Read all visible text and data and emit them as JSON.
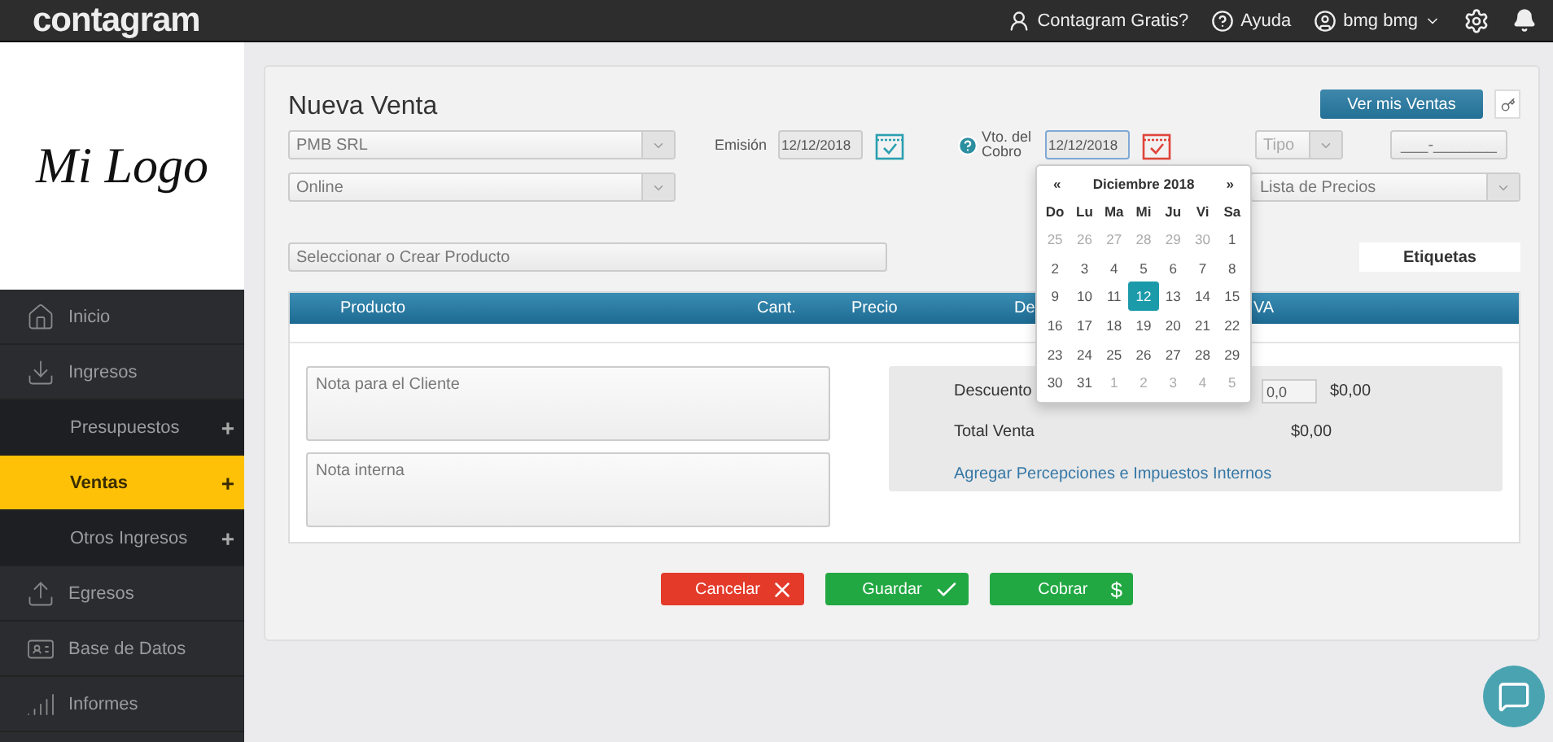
{
  "topbar": {
    "logo": "contagram",
    "links": [
      {
        "label": "Contagram Gratis?"
      },
      {
        "label": "Ayuda"
      },
      {
        "label": "bmg bmg"
      }
    ]
  },
  "sidebar": {
    "logo": "Mi Logo",
    "items": [
      {
        "label": "Inicio",
        "kind": "main",
        "selected": false
      },
      {
        "label": "Ingresos",
        "kind": "main",
        "selected": false
      },
      {
        "label": "Presupuestos",
        "kind": "sub",
        "selected": false,
        "plus": "+"
      },
      {
        "label": "Ventas",
        "kind": "sub",
        "selected": true,
        "plus": "+"
      },
      {
        "label": "Otros Ingresos",
        "kind": "sub",
        "selected": false,
        "plus": "+"
      },
      {
        "label": "Egresos",
        "kind": "main",
        "selected": false
      },
      {
        "label": "Base de Datos",
        "kind": "main",
        "selected": false
      },
      {
        "label": "Informes",
        "kind": "main",
        "selected": false
      }
    ]
  },
  "form": {
    "title": "Nueva Venta",
    "view_button": "Ver mis Ventas",
    "client": "PMB SRL",
    "channel": "Online",
    "issue_label": "Emisión",
    "issue_date": "12/12/2018",
    "due_label": "Vto. del Cobro",
    "due_date": "12/12/2018",
    "type_placeholder": "Tipo",
    "number_placeholder": "___-_______",
    "price_list": "Lista de Precios",
    "product_placeholder": "Seleccionar o Crear Producto",
    "tags_button": "Etiquetas",
    "columns": [
      "Producto",
      "Cant.",
      "Precio",
      "De",
      "VA"
    ],
    "client_note_placeholder": "Nota para el Cliente",
    "internal_note_placeholder": "Nota interna",
    "discount_label": "Descuento",
    "discount_value": "0,0",
    "discount_amount": "$0,00",
    "total_label": "Total Venta",
    "total_amount": "$0,00",
    "taxes_link": "Agregar Percepciones e Impuestos Internos",
    "buttons": [
      {
        "label": "Cancelar",
        "kind": "cancel"
      },
      {
        "label": "Guardar",
        "kind": "save"
      },
      {
        "label": "Cobrar",
        "kind": "charge",
        "symbol": "$"
      }
    ]
  },
  "datepicker": {
    "prev": "«",
    "month": "Diciembre 2018",
    "next": "»",
    "weekdays": [
      "Do",
      "Lu",
      "Ma",
      "Mi",
      "Ju",
      "Vi",
      "Sa"
    ],
    "weeks": [
      [
        {
          "label": "25",
          "muted": true,
          "selected": false
        },
        {
          "label": "26",
          "muted": true,
          "selected": false
        },
        {
          "label": "27",
          "muted": true,
          "selected": false
        },
        {
          "label": "28",
          "muted": true,
          "selected": false
        },
        {
          "label": "29",
          "muted": true,
          "selected": false
        },
        {
          "label": "30",
          "muted": true,
          "selected": false
        },
        {
          "label": "1",
          "muted": false,
          "selected": false
        }
      ],
      [
        {
          "label": "2",
          "muted": false,
          "selected": false
        },
        {
          "label": "3",
          "muted": false,
          "selected": false
        },
        {
          "label": "4",
          "muted": false,
          "selected": false
        },
        {
          "label": "5",
          "muted": false,
          "selected": false
        },
        {
          "label": "6",
          "muted": false,
          "selected": false
        },
        {
          "label": "7",
          "muted": false,
          "selected": false
        },
        {
          "label": "8",
          "muted": false,
          "selected": false
        }
      ],
      [
        {
          "label": "9",
          "muted": false,
          "selected": false
        },
        {
          "label": "10",
          "muted": false,
          "selected": false
        },
        {
          "label": "11",
          "muted": false,
          "selected": false
        },
        {
          "label": "12",
          "muted": false,
          "selected": true
        },
        {
          "label": "13",
          "muted": false,
          "selected": false
        },
        {
          "label": "14",
          "muted": false,
          "selected": false
        },
        {
          "label": "15",
          "muted": false,
          "selected": false
        }
      ],
      [
        {
          "label": "16",
          "muted": false,
          "selected": false
        },
        {
          "label": "17",
          "muted": false,
          "selected": false
        },
        {
          "label": "18",
          "muted": false,
          "selected": false
        },
        {
          "label": "19",
          "muted": false,
          "selected": false
        },
        {
          "label": "20",
          "muted": false,
          "selected": false
        },
        {
          "label": "21",
          "muted": false,
          "selected": false
        },
        {
          "label": "22",
          "muted": false,
          "selected": false
        }
      ],
      [
        {
          "label": "23",
          "muted": false,
          "selected": false
        },
        {
          "label": "24",
          "muted": false,
          "selected": false
        },
        {
          "label": "25",
          "muted": false,
          "selected": false
        },
        {
          "label": "26",
          "muted": false,
          "selected": false
        },
        {
          "label": "27",
          "muted": false,
          "selected": false
        },
        {
          "label": "28",
          "muted": false,
          "selected": false
        },
        {
          "label": "29",
          "muted": false,
          "selected": false
        }
      ],
      [
        {
          "label": "30",
          "muted": false,
          "selected": false
        },
        {
          "label": "31",
          "muted": false,
          "selected": false
        },
        {
          "label": "1",
          "muted": true,
          "selected": false
        },
        {
          "label": "2",
          "muted": true,
          "selected": false
        },
        {
          "label": "3",
          "muted": true,
          "selected": false
        },
        {
          "label": "4",
          "muted": true,
          "selected": false
        },
        {
          "label": "5",
          "muted": true,
          "selected": false
        }
      ]
    ]
  }
}
